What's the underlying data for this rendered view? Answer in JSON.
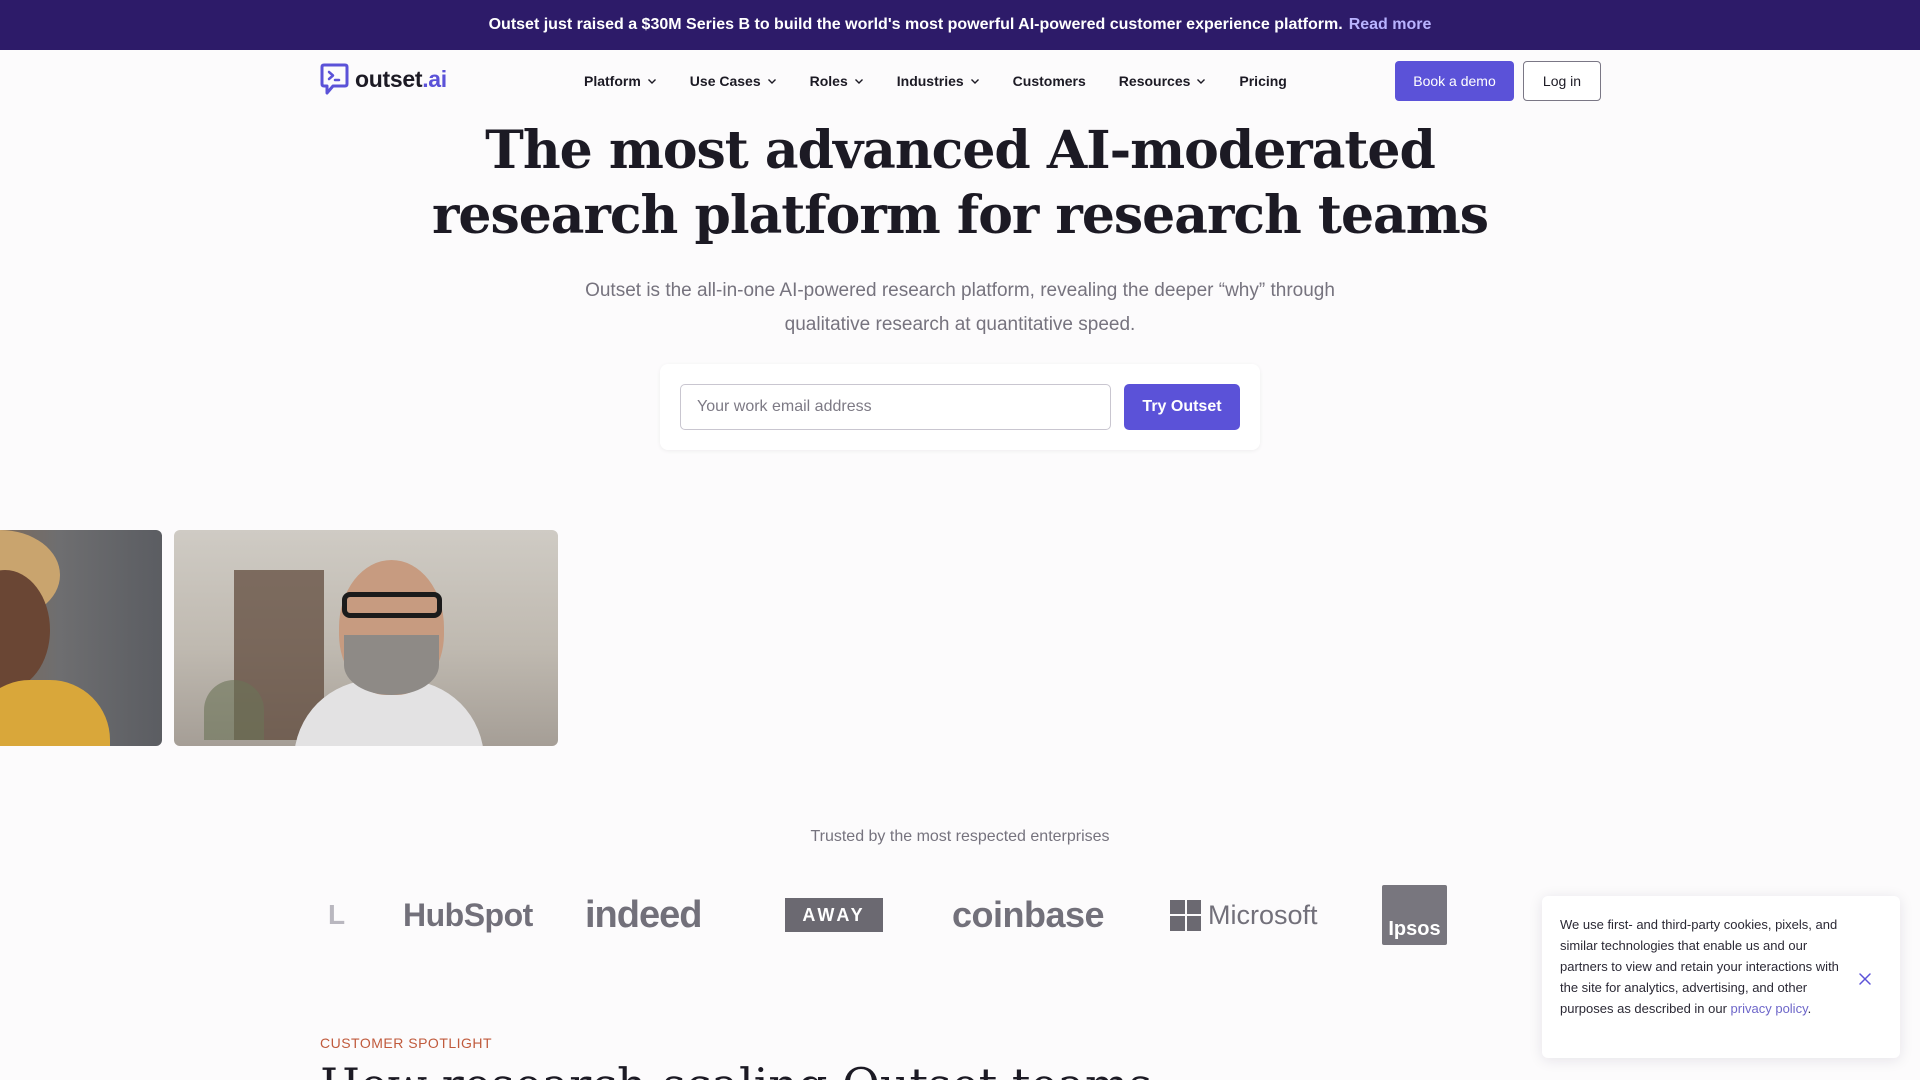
{
  "announcement": {
    "text": "Outset just raised a $30M Series B to build the world's most powerful AI-powered customer experience platform.",
    "link": "Read more"
  },
  "brand": {
    "name_main": "outset",
    "name_accent": ".ai",
    "accent_color": "#5b52d8",
    "banner_color": "#2d1b69"
  },
  "nav": {
    "items": [
      {
        "label": "Platform",
        "dropdown": true
      },
      {
        "label": "Use Cases",
        "dropdown": true
      },
      {
        "label": "Roles",
        "dropdown": true
      },
      {
        "label": "Industries",
        "dropdown": true
      },
      {
        "label": "Customers",
        "dropdown": false
      },
      {
        "label": "Resources",
        "dropdown": true
      },
      {
        "label": "Pricing",
        "dropdown": false
      }
    ],
    "book_demo": "Book a demo",
    "login": "Log in"
  },
  "hero": {
    "title_line1": "The most advanced AI-moderated",
    "title_line2": "research platform for research teams",
    "subtitle": "Outset is the all-in-one AI-powered research platform, revealing the deeper “why” through qualitative research at quantitative speed.",
    "email_placeholder": "Your work email address",
    "cta": "Try Outset"
  },
  "trusted": {
    "heading": "Trusted by the most respected enterprises",
    "logos": {
      "hubspot": "HubSpot",
      "indeed": "indeed",
      "away": "AWAY",
      "coinbase": "coinbase",
      "microsoft": "Microsoft",
      "ipsos": "Ipsos"
    }
  },
  "spotlight": {
    "label": "CUSTOMER SPOTLIGHT",
    "title": "How research-scaling Outset teams"
  },
  "cookie": {
    "text": "We use first- and third-party cookies, pixels, and similar technologies that enable us and our partners to view and retain your interactions with the site for analytics, advertising, and other purposes as described in our ",
    "link": "privacy policy",
    "end": "."
  }
}
